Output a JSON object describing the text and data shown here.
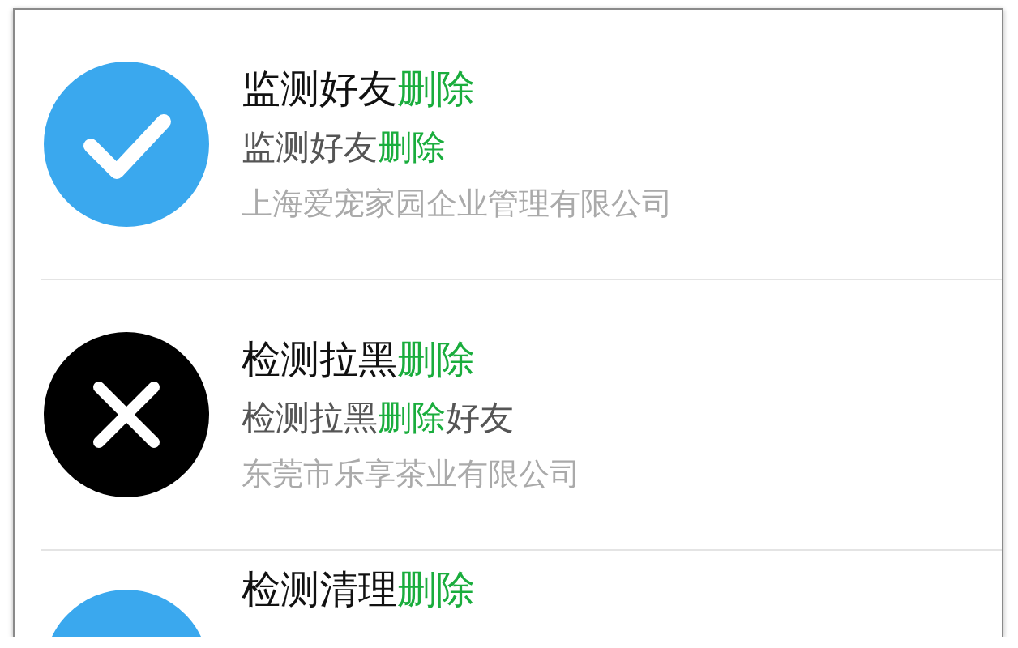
{
  "items": [
    {
      "kind": "check",
      "title": [
        {
          "text": "监测好友",
          "highlight": false
        },
        {
          "text": "删除",
          "highlight": true
        }
      ],
      "subtitle": [
        {
          "text": "监测好友",
          "highlight": false
        },
        {
          "text": "删除",
          "highlight": true
        }
      ],
      "company": "上海爱宠家园企业管理有限公司"
    },
    {
      "kind": "cross",
      "title": [
        {
          "text": "检测拉黑",
          "highlight": false
        },
        {
          "text": "删除",
          "highlight": true
        }
      ],
      "subtitle": [
        {
          "text": "检测拉黑",
          "highlight": false
        },
        {
          "text": "删除",
          "highlight": true
        },
        {
          "text": "好友",
          "highlight": false
        }
      ],
      "company": "东莞市乐享茶业有限公司"
    },
    {
      "kind": "plain",
      "title": [
        {
          "text": "检测清理",
          "highlight": false
        },
        {
          "text": "删除",
          "highlight": true
        }
      ]
    }
  ]
}
